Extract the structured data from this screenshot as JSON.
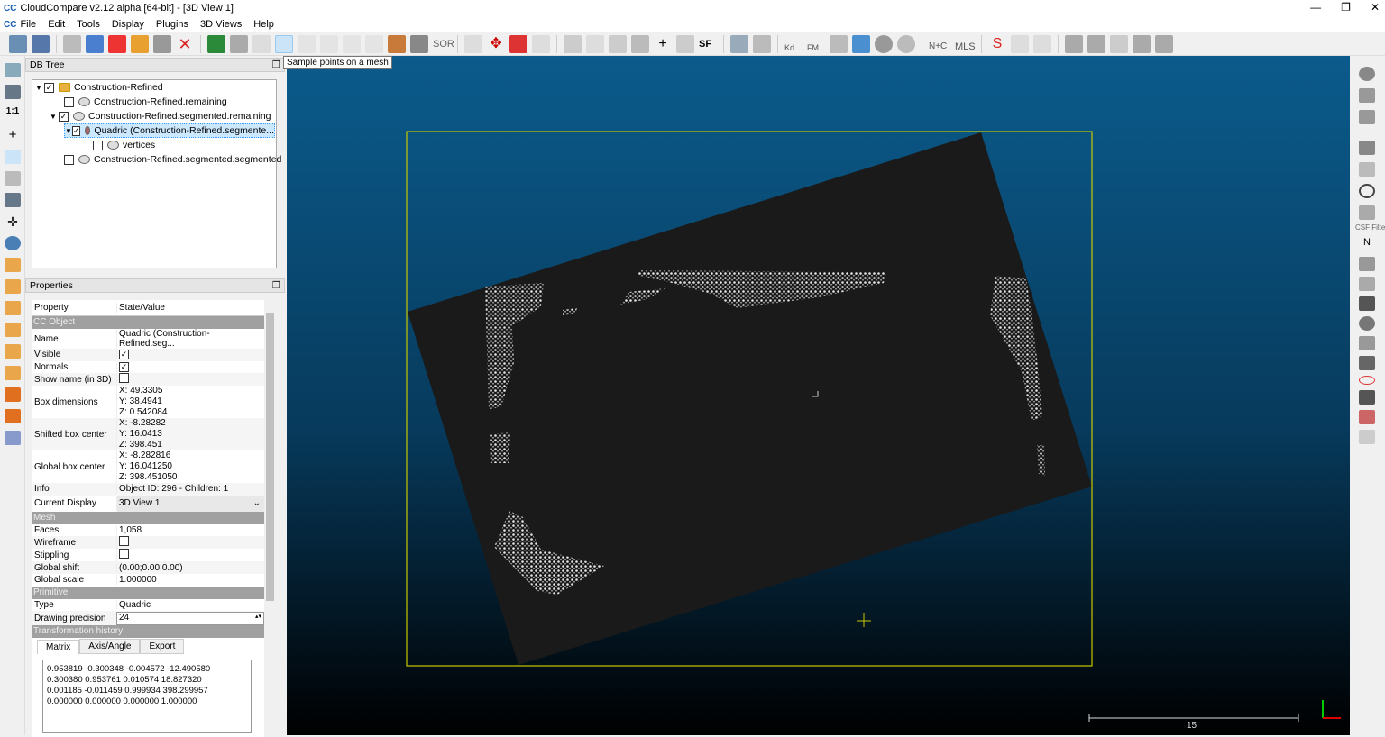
{
  "window": {
    "title": "CloudCompare v2.12 alpha [64-bit] - [3D View 1]",
    "logo": "CC",
    "controls": [
      "—",
      "❐",
      "✕"
    ]
  },
  "menu": [
    "File",
    "Edit",
    "Tools",
    "Display",
    "Plugins",
    "3D Views",
    "Help"
  ],
  "toolbar": {
    "tooltip": "Sample points on a mesh",
    "text_icons": [
      "SOR",
      "SF",
      "Kd",
      "FM",
      "N+C",
      "MLS"
    ]
  },
  "dbtree": {
    "title": "DB Tree",
    "items": [
      {
        "label": "Construction-Refined",
        "checked": true,
        "expanded": true,
        "level": 0
      },
      {
        "label": "Construction-Refined.remaining",
        "checked": false,
        "level": 1
      },
      {
        "label": "Construction-Refined.segmented.remaining",
        "checked": true,
        "expanded": true,
        "level": 1
      },
      {
        "label": "Quadric (Construction-Refined.segmente...",
        "checked": true,
        "expanded": true,
        "level": 2,
        "selected": true
      },
      {
        "label": "vertices",
        "checked": false,
        "level": 3
      },
      {
        "label": "Construction-Refined.segmented.segmented",
        "checked": false,
        "level": 1
      }
    ]
  },
  "properties": {
    "title": "Properties",
    "col_property": "Property",
    "col_value": "State/Value",
    "sections": {
      "cc_object": "CC Object",
      "mesh": "Mesh",
      "primitive": "Primitive",
      "transform": "Transformation history"
    },
    "name": {
      "k": "Name",
      "v": "Quadric (Construction-Refined.seg..."
    },
    "visible": {
      "k": "Visible",
      "checked": true
    },
    "normals": {
      "k": "Normals",
      "checked": true
    },
    "showname": {
      "k": "Show name (in 3D)",
      "checked": false
    },
    "box_dims": {
      "k": "Box dimensions",
      "x": "X: 49.3305",
      "y": "Y: 38.4941",
      "z": "Z: 0.542084"
    },
    "shifted": {
      "k": "Shifted box center",
      "x": "X: -8.28282",
      "y": "Y: 16.0413",
      "z": "Z: 398.451"
    },
    "global": {
      "k": "Global box center",
      "x": "X: -8.282816",
      "y": "Y: 16.041250",
      "z": "Z: 398.451050"
    },
    "info": {
      "k": "Info",
      "v": "Object ID: 296 - Children: 1"
    },
    "display": {
      "k": "Current Display",
      "v": "3D View 1"
    },
    "faces": {
      "k": "Faces",
      "v": "1,058"
    },
    "wireframe": {
      "k": "Wireframe",
      "checked": false
    },
    "stippling": {
      "k": "Stippling",
      "checked": false
    },
    "gshift": {
      "k": "Global shift",
      "v": "(0.00;0.00;0.00)"
    },
    "gscale": {
      "k": "Global scale",
      "v": "1.000000"
    },
    "type": {
      "k": "Type",
      "v": "Quadric"
    },
    "precision": {
      "k": "Drawing precision",
      "v": "24"
    },
    "tabs": [
      "Matrix",
      "Axis/Angle",
      "Export"
    ],
    "matrix": [
      "0.953819 -0.300348 -0.004572 -12.490580",
      "0.300380 0.953761 0.010574 18.827320",
      "0.001185 -0.011459 0.999934 398.299957",
      "0.000000 0.000000 0.000000 1.000000"
    ]
  },
  "view": {
    "scale_label": "15",
    "right_label": "CSF Filte",
    "colors": {
      "bbox": "#c8c800",
      "mesh": "#1a1a1a",
      "points": "#e0e0e0"
    }
  }
}
